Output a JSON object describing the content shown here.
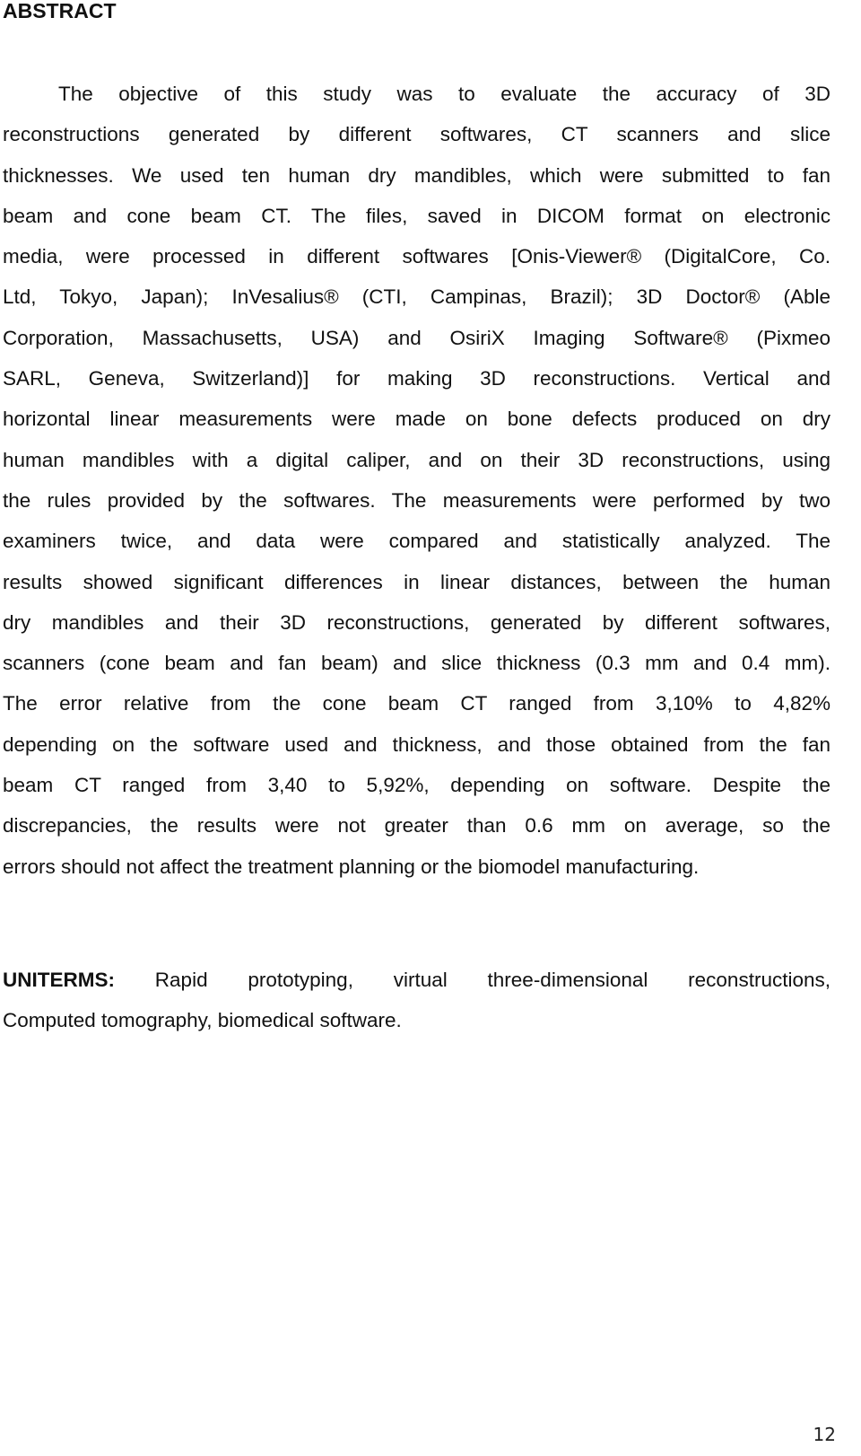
{
  "document": {
    "heading": "ABSTRACT",
    "abstract_lines": [
      "The objective of this study was to evaluate the accuracy of 3D",
      "reconstructions generated by different softwares, CT scanners and slice",
      "thicknesses. We used ten human dry mandibles, which were submitted to fan",
      "beam and cone beam CT. The files, saved in DICOM format on electronic",
      "media, were processed in different softwares [Onis-Viewer® (DigitalCore, Co.",
      "Ltd, Tokyo, Japan); InVesalius® (CTI, Campinas, Brazil); 3D Doctor® (Able",
      "Corporation, Massachusetts, USA) and OsiriX Imaging Software® (Pixmeo",
      "SARL, Geneva, Switzerland)] for making 3D reconstructions. Vertical and",
      "horizontal linear measurements were made on bone defects produced on dry",
      "human mandibles with a digital caliper, and on their 3D reconstructions, using",
      "the rules provided by the softwares. The measurements were performed by two",
      "examiners twice, and data were compared and statistically analyzed. The",
      "results showed significant differences in linear distances, between the human",
      "dry mandibles and their 3D reconstructions, generated by different softwares,",
      "scanners (cone beam and fan beam) and slice thickness (0.3 mm and 0.4 mm).",
      "The error relative from the cone beam CT ranged from 3,10% to 4,82%",
      "depending on the software used and thickness, and those obtained from the fan",
      "beam CT ranged from 3,40 to 5,92%, depending on software. Despite the",
      "discrepancies, the results were not greater than 0.6 mm on average, so the",
      "errors should not affect the treatment planning or the biomodel manufacturing."
    ],
    "uniterms": {
      "label": "UNITERMS:",
      "line1": "Rapid prototyping, virtual three-dimensional reconstructions,",
      "line2": "Computed tomography, biomedical software."
    },
    "page_number": "12"
  }
}
